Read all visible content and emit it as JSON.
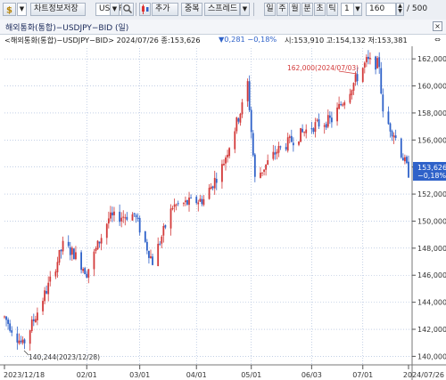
{
  "toolbar": {
    "left_icon": "dollar-s-icon",
    "save_chart_label": "차트정보저장",
    "symbol_value": "USDJPY",
    "search_icon": "magnifier-icon",
    "add_label": "추가",
    "overlay_label": "중복",
    "spread_label": "스프레드",
    "period_buttons": [
      "일",
      "주",
      "월",
      "분",
      "초",
      "틱"
    ],
    "interval_value": "1",
    "count_value": "160",
    "count_total": "/ 500"
  },
  "panel": {
    "title": "해외통화(통합)−USDJPY−BID (일)"
  },
  "info": {
    "prefix": "<해외통화(통합)−USDJPY−BID> 2024/07/26 종:153,626",
    "change": "▼0,281 −0,18%",
    "ohlc": "시:153,910 고:154,132 저:153,381"
  },
  "annotations": {
    "high_label": "162,000(2024/07/03)",
    "low_label": "140,244(2023/12/28)"
  },
  "price_tag": {
    "price": "153,626",
    "pct": "−0,18%"
  },
  "axis": {
    "y_ticks": [
      "162,000",
      "160,000",
      "158,000",
      "156,000",
      "154,000",
      "152,000",
      "150,000",
      "148,000",
      "146,000",
      "144,000",
      "142,000",
      "140,000"
    ],
    "x_ticks": [
      "2023/12/18",
      "02/01",
      "03/01",
      "04/01",
      "05/01",
      "06/03",
      "07/01",
      "2024/07/26"
    ]
  },
  "colors": {
    "up": "#d33a3a",
    "down": "#2f62c9",
    "grid": "#9fb3d6",
    "axis_bg": "#ffffff"
  },
  "chart_data": {
    "type": "candlestick",
    "x_range": [
      "2023/12/18",
      "2024/07/26"
    ],
    "ylim": [
      139.5,
      162.8
    ],
    "anchors": [
      {
        "date": "2023/12/18",
        "price": 142.9
      },
      {
        "date": "2023/12/28",
        "price": 140.8
      },
      {
        "date": "2024/01/11",
        "price": 145.2
      },
      {
        "date": "2024/01/19",
        "price": 148.2
      },
      {
        "date": "2024/01/25",
        "price": 147.6
      },
      {
        "date": "2024/02/01",
        "price": 146.2
      },
      {
        "date": "2024/02/13",
        "price": 150.2
      },
      {
        "date": "2024/02/27",
        "price": 150.5
      },
      {
        "date": "2024/03/08",
        "price": 147.0
      },
      {
        "date": "2024/03/19",
        "price": 151.1
      },
      {
        "date": "2024/04/05",
        "price": 151.6
      },
      {
        "date": "2024/04/15",
        "price": 154.0
      },
      {
        "date": "2024/04/26",
        "price": 158.5
      },
      {
        "date": "2024/04/29",
        "price": 160.2
      },
      {
        "date": "2024/05/03",
        "price": 153.1
      },
      {
        "date": "2024/05/15",
        "price": 155.2
      },
      {
        "date": "2024/06/03",
        "price": 157.0
      },
      {
        "date": "2024/06/14",
        "price": 157.5
      },
      {
        "date": "2024/07/03",
        "price": 161.8
      },
      {
        "date": "2024/07/10",
        "price": 161.6
      },
      {
        "date": "2024/07/12",
        "price": 157.8
      },
      {
        "date": "2024/07/18",
        "price": 156.5
      },
      {
        "date": "2024/07/26",
        "price": 153.6
      }
    ]
  }
}
